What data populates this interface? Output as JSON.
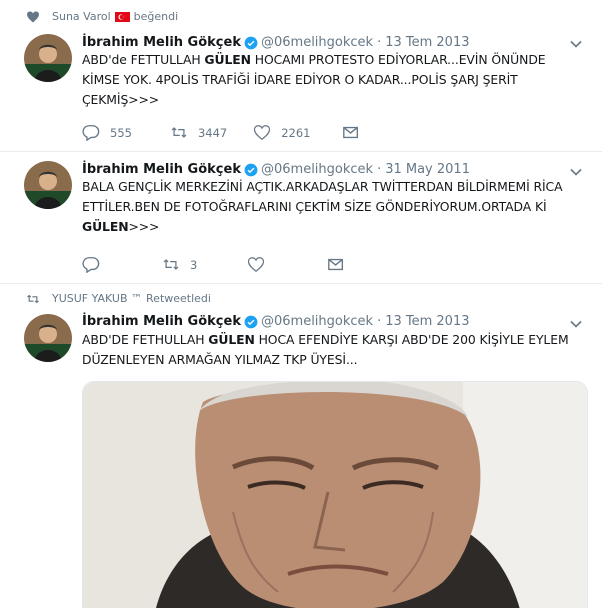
{
  "tweets": [
    {
      "context": {
        "user": "Suna Varol",
        "action": "beğendi",
        "icon": "heart-icon"
      },
      "author": {
        "name": "İbrahim Melih Gökçek",
        "handle": "@06melihgokcek"
      },
      "date": "13 Tem 2013",
      "text": {
        "p1": "ABD'de FETTULLAH ",
        "p2": "GÜLEN",
        "p3": " HOCAMI PROTESTO EDİYORLAR...EVİN ÖNÜNDE KİMSE YOK. 4POLİS TRAFİĞİ İDARE EDİYOR O KADAR...POLİS ŞARJ ŞERİT ÇEKMİŞ>>>"
      },
      "replies": "555",
      "retweets": "3447",
      "likes": "2261"
    },
    {
      "author": {
        "name": "İbrahim Melih Gökçek",
        "handle": "@06melihgokcek"
      },
      "date": "31 May 2011",
      "text": {
        "p1": "BALA GENÇLİK MERKEZİNİ AÇTIK.ARKADAŞLAR TWİTTERDAN BİLDİRMEMİ RİCA ETTİLER.BEN DE FOTOĞRAFLARINI ÇEKTİM SİZE GÖNDERİYORUM.ORTADA Kİ ",
        "p2": "GÜLEN",
        "p3": ">>>"
      },
      "retweets": "3"
    },
    {
      "context": {
        "user": "YUSUF YAKUB ™",
        "action": "Retweetledi",
        "icon": "retweet-icon"
      },
      "author": {
        "name": "İbrahim Melih Gökçek",
        "handle": "@06melihgokcek"
      },
      "date": "13 Tem 2013",
      "text": {
        "p1": "ABD'DE FETHULLAH ",
        "p2": "GÜLEN",
        "p3": " HOCA EFENDİYE KARŞI ABD'DE 200 KİŞİYLE EYLEM DÜZENLEYEN ARMAĞAN YILMAZ TKP ÜYESİ..."
      }
    }
  ],
  "colors": {
    "text": "#14171a",
    "muted": "#657786",
    "verified": "#1da1f2",
    "divider": "#e6ecf0"
  }
}
